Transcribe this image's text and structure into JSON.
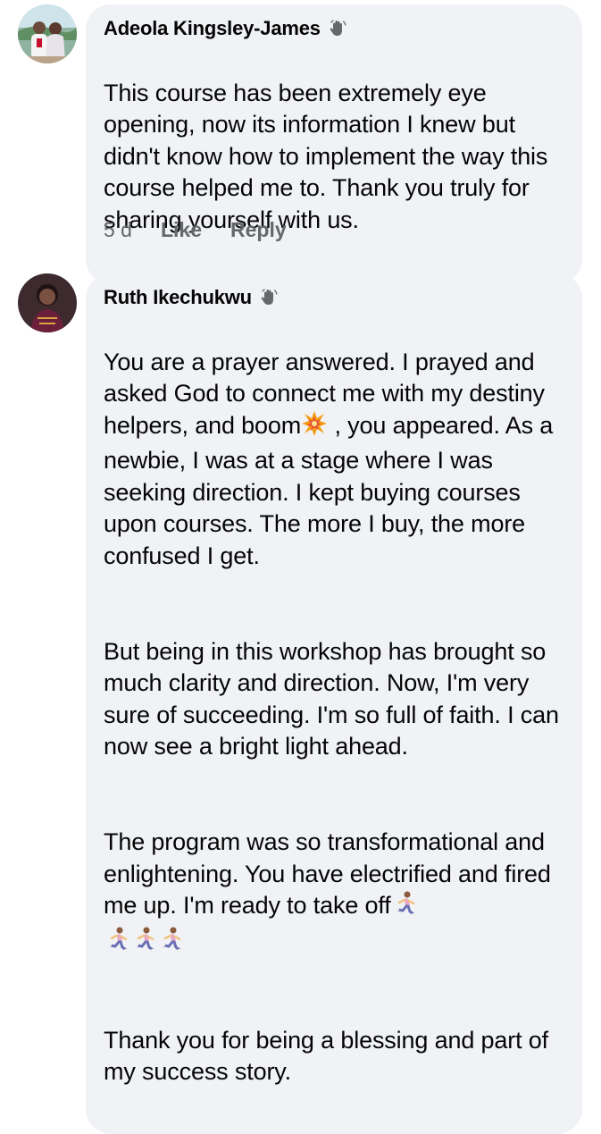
{
  "comments": [
    {
      "author": "Adeola Kingsley-James",
      "badge_icon": "wave-hand-icon",
      "paragraphs": [
        "This course has been extremely eye opening, now its information I knew but didn't know how to implement the way this course helped me to. Thank you truly for sharing yourself with us."
      ],
      "time": "5 d",
      "like_label": "Like",
      "reply_label": "Reply"
    },
    {
      "author": "Ruth Ikechukwu",
      "badge_icon": "wave-hand-icon",
      "p1_before": "You are a prayer answered. I prayed and asked God to connect me with my destiny helpers, and boom",
      "p1_emoji": "collision-emoji",
      "p1_after": " , you appeared. As a newbie, I was at a stage where I was seeking direction. I kept buying courses upon courses. The more I buy, the more confused I get.",
      "p2": "But being in this workshop has brought so much clarity and direction. Now, I'm very sure of succeeding. I'm so full of faith. I can now see a bright light ahead.",
      "p3": "The program was so transformational and enlightening. You have electrified and fired me up. I'm ready to take off",
      "p3_emoji": "woman-running-emoji",
      "p4": "Thank you for being a blessing and part of my success story."
    }
  ],
  "colors": {
    "bubble": "#f0f2f5",
    "text": "#050505",
    "meta": "#65676b"
  }
}
